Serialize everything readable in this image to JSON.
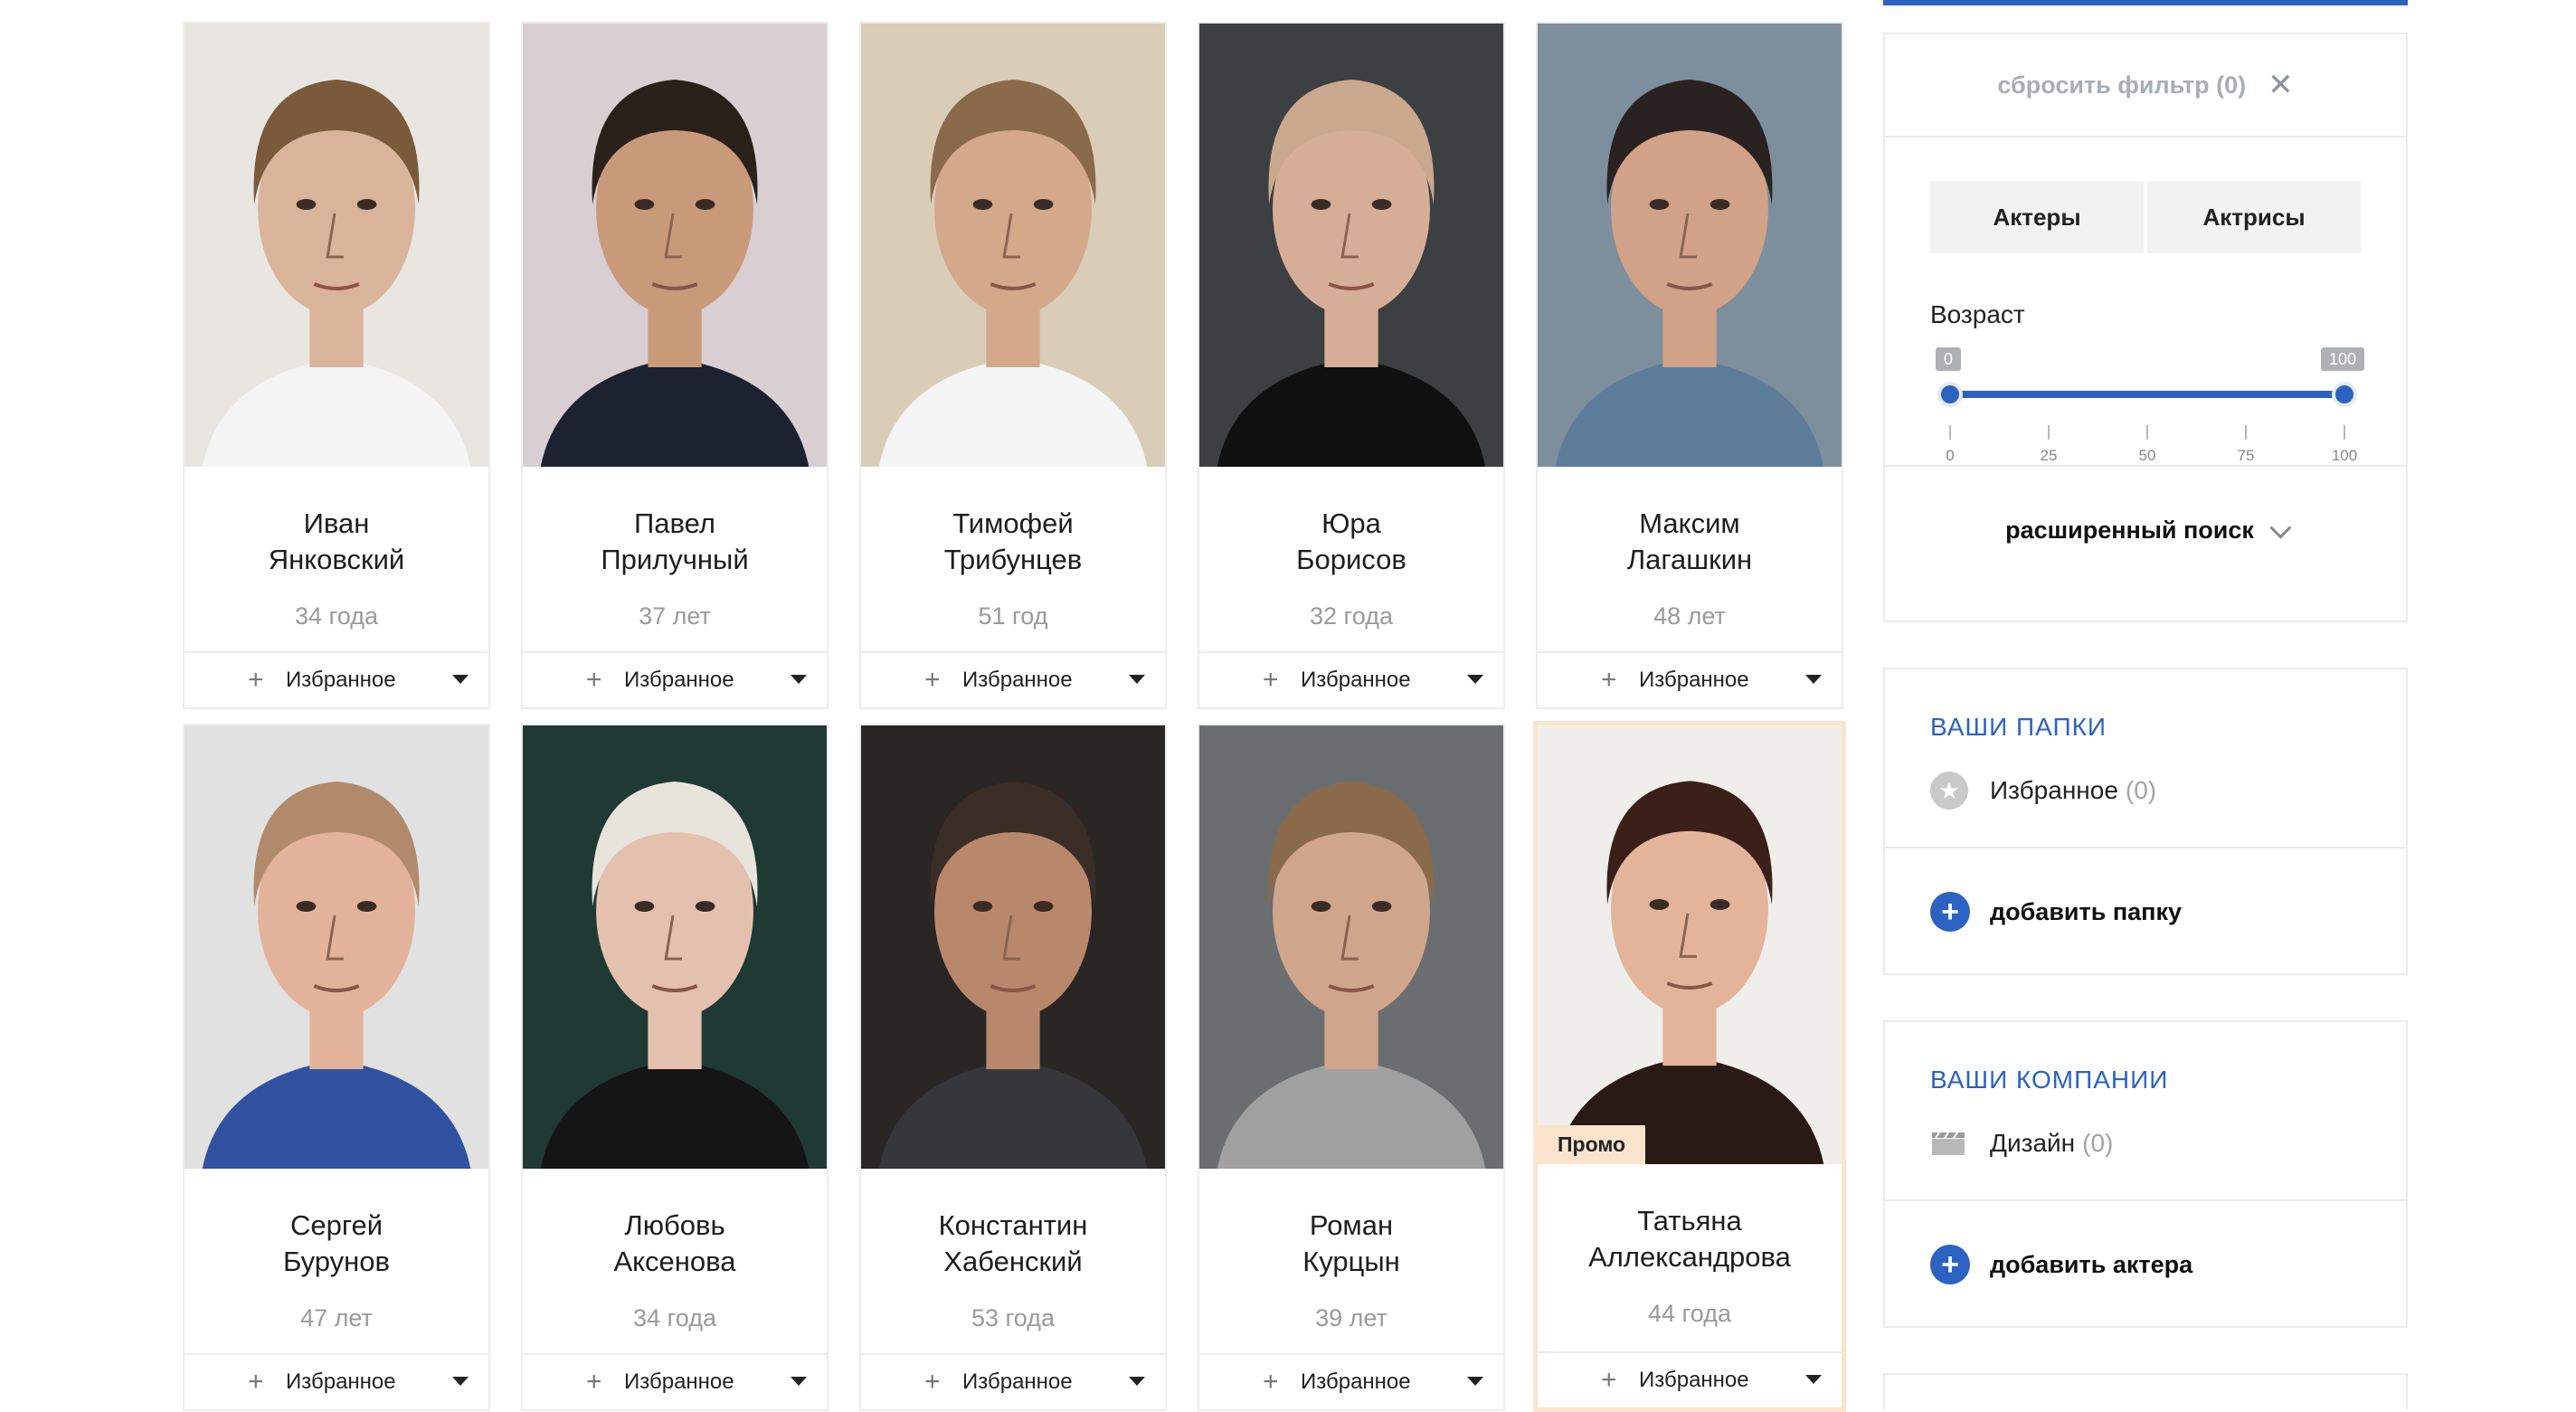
{
  "actors": [
    {
      "first": "Иван",
      "last": "Янковский",
      "age": "34 года",
      "fav": "Избранное",
      "promo": false,
      "skin": "#d9b49a",
      "hair": "#7a5a3a",
      "bg": "#e9e6e2",
      "shirt": "#f4f4f4"
    },
    {
      "first": "Павел",
      "last": "Прилучный",
      "age": "37 лет",
      "fav": "Избранное",
      "promo": false,
      "skin": "#c99a7a",
      "hair": "#2a211b",
      "bg": "#d9cfd2",
      "shirt": "#1c2230"
    },
    {
      "first": "Тимофей",
      "last": "Трибунцев",
      "age": "51 год",
      "fav": "Избранное",
      "promo": false,
      "skin": "#d3a88b",
      "hair": "#8a6a4a",
      "bg": "#d9cdb8",
      "shirt": "#f5f5f5"
    },
    {
      "first": "Юра",
      "last": "Борисов",
      "age": "32 года",
      "fav": "Избранное",
      "promo": false,
      "skin": "#d6ae98",
      "hair": "#c9a88e",
      "bg": "#3d4043",
      "shirt": "#101010"
    },
    {
      "first": "Максим",
      "last": "Лагашкин",
      "age": "48 лет",
      "fav": "Избранное",
      "promo": false,
      "skin": "#d1a287",
      "hair": "#2a2220",
      "bg": "#7d8f9c",
      "shirt": "#5d7c9a"
    },
    {
      "first": "Сергей",
      "last": "Бурунов",
      "age": "47 лет",
      "fav": "Избранное",
      "promo": false,
      "skin": "#e2b39a",
      "hair": "#b08a6a",
      "bg": "#e1e1e1",
      "shirt": "#3052a0"
    },
    {
      "first": "Любовь",
      "last": "Аксенова",
      "age": "34 года",
      "fav": "Избранное",
      "promo": false,
      "skin": "#e4c1ae",
      "hair": "#e8e4dc",
      "bg": "#1f3a33",
      "shirt": "#151515"
    },
    {
      "first": "Константин",
      "last": "Хабенский",
      "age": "53 года",
      "fav": "Избранное",
      "promo": false,
      "skin": "#b9886c",
      "hair": "#3a2e26",
      "bg": "#2a2624",
      "shirt": "#35373a"
    },
    {
      "first": "Роман",
      "last": "Курцын",
      "age": "39 лет",
      "fav": "Избранное",
      "promo": false,
      "skin": "#cfa58c",
      "hair": "#8b6a4c",
      "bg": "#6b6e70",
      "shirt": "#a0a0a0"
    },
    {
      "first": "Татьяна",
      "last": "Аллександрова",
      "age": "44 года",
      "fav": "Избранное",
      "promo": true,
      "promo_label": "Промо",
      "skin": "#e3b49a",
      "hair": "#3a2018",
      "bg": "#efeeea",
      "shirt": "#2a1a16"
    }
  ],
  "filter": {
    "reset_label": "сбросить фильтр (0)",
    "reset_icon": "close-icon",
    "gender_actors": "Актеры",
    "gender_actresses": "Актрисы",
    "age_label": "Возраст",
    "age_min": "0",
    "age_max": "100",
    "age_range": [
      0,
      100
    ],
    "ticks": [
      "0",
      "25",
      "50",
      "75",
      "100"
    ],
    "advanced": "расширенный поиск"
  },
  "folders": {
    "title": "ВАШИ ПАПКИ",
    "item_label": "Избранное",
    "item_count": "(0)",
    "add_label": "добавить папку"
  },
  "companies": {
    "title": "ВАШИ КОМПАНИИ",
    "item_label": "Дизайн",
    "item_count": "(0)",
    "add_label": "добавить актера"
  },
  "colors": {
    "accent": "#2c62c1",
    "promo": "#fbe4cc"
  }
}
